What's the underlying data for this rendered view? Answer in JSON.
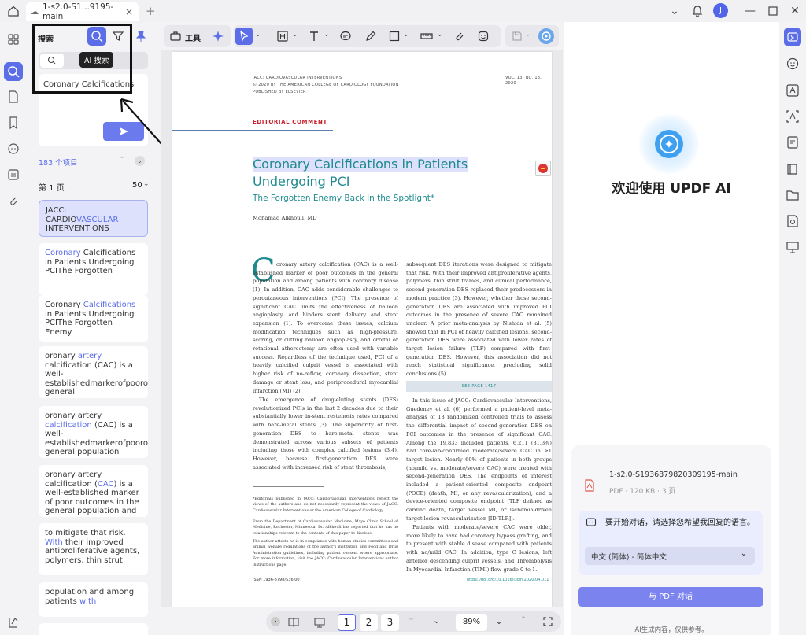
{
  "tab": {
    "title": "1-s2.0-S1...9195-main",
    "new_tab": "+"
  },
  "search_panel": {
    "title": "搜索",
    "ai_tooltip": "AI 搜索",
    "query": "Coronary Calcifications",
    "count": "183 个项目",
    "page_label": "第 1 页",
    "page_count": "50",
    "results": [
      {
        "pre": "JACC: CARDIO",
        "hit": "VASCULAR",
        "post": " INTERVENTIONS"
      },
      {
        "pre": "",
        "hit": "Coronary",
        "post": " Calcifications in Patients Undergoing PCIThe Forgotten"
      },
      {
        "pre": "Coronary ",
        "hit": "Calcifications",
        "post": " in Patients Undergoing PCIThe Forgotten Enemy"
      },
      {
        "pre": "oronary ",
        "hit": "artery",
        "post": " calcification (CAC) is a well-establishedmarkerofpoorou general"
      },
      {
        "pre": "oronary artery ",
        "hit": "calcification",
        "post": " (CAC) is a well-establishedmarkerofpoorou general population"
      },
      {
        "pre": "oronary artery calcification (",
        "hit": "CAC",
        "post": ") is a well-established marker of poor outcomes in the general population and"
      },
      {
        "pre": "to mitigate that risk. ",
        "hit": "With",
        "post": " their improved antiproliferative agents, polymers, thin strut"
      },
      {
        "pre": "population and among patients ",
        "hit": "with",
        "post": ""
      }
    ]
  },
  "toolbar": {
    "tools_label": "工具"
  },
  "document": {
    "journal": "JACC: CARDIOVASCULAR INTERVENTIONS",
    "copyright": "© 2020 BY THE AMERICAN COLLEGE OF CARDIOLOGY FOUNDATION",
    "publisher": "PUBLISHED BY ELSEVIER",
    "volume": "VOL. 13, NO. 13, 2020",
    "section": "EDITORIAL COMMENT",
    "title1": "Coronary Calcifications in Patients",
    "title2": "Undergoing PCI",
    "subtitle": "The Forgotten Enemy Back in the Spotlight*",
    "author": "Mohamad Alkhouli, MD",
    "dropcap": "C",
    "col1_p1": "oronary artery calcification (CAC) is a well-established marker of poor outcomes in the general population and among patients with coronary disease (1). In addition, CAC adds considerable challenges to percutaneous interventions (PCI). The presence of significant CAC limits the effectiveness of balloon angioplasty, and hinders stent delivery and stent expansion (1). To overcome these issues, calcium modification techniques such as high-pressure, scoring, or cutting balloon angioplasty, and orbital or rotational atherectomy are often used with variable success. Regardless of the technique used, PCI of a heavily calcified culprit vessel is associated with higher risk of no-reflow, coronary dissection, stent damage or stent loss, and periprocedural myocardial infarction (MI) (2).",
    "col1_p2": "The emergence of drug-eluting stents (DES) revolutionized PCIs in the last 2 decades due to their substantially lower in-stent restenosis rates compared with bare-metal stents (3). The superiority of first-generation DES to bare-metal stents was demonstrated across various subsets of patients including those with complex calcified lesions (3,4). However, because first-generation DES were associated with increased risk of stent thrombosis,",
    "footnote1": "*Editorials published in JACC: Cardiovascular Interventions reflect the views of the authors and do not necessarily represent the views of JACC: Cardiovascular Interventions or the American College of Cardiology.",
    "footnote2": "From the Department of Cardiovascular Medicine, Mayo Clinic School of Medicine, Rochester, Minnesota. Dr. Alkhouli has reported that he has no relationships relevant to the contents of this paper to disclose.",
    "footnote3": "The author attests he is in compliance with human studies committees and animal welfare regulations of the author's institution and Food and Drug Administration guidelines, including patient consent where appropriate. For more information, visit the JACC: Cardiovascular Interventions author instructions page.",
    "issn": "ISSN 1936-8798/$36.00",
    "doi": "https://doi.org/10.1016/j.jcin.2020.04.011",
    "col2_p1": "subsequent DES iterations were designed to mitigate that risk. With their improved antiproliferative agents, polymers, thin strut frames, and clinical performance, second-generation DES replaced their predecessors in modern practice (3). However, whether those second-generation DES are associated with improved PCI outcomes in the presence of severe CAC remained unclear. A prior meta-analysis by Nishida et al. (5) showed that in PCI of heavily calcified lesions, second-generation DES were associated with lower rates of target lesion failure (TLF) compared with first-generation DES. However, this association did not reach statistical significance, precluding solid conclusions (5).",
    "see_page": "SEE PAGE 1417",
    "col2_p2": "In this issue of JACC: Cardiovascular Interventions, Guedeney et al. (6) performed a patient-level meta-analysis of 18 randomized controlled trials to assess the differential impact of second-generation DES on PCI outcomes in the presence of significant CAC. Among the 19,833 included patients, 6,211 (31.3%) had core-lab-confirmed moderate/severe CAC in ≥1 target lesion. Nearly 60% of patients in both groups (no/mild vs. moderate/severe CAC) were treated with second-generation DES. The endpoints of interest included a patient-oriented composite endpoint (POCE) (death, MI, or any revascularization), and a device-oriented composite endpoint (TLF defined as cardiac death, target vessel MI, or ischemia-driven target lesion revascularization [ID-TLR]).",
    "col2_p3": "Patients with moderate/severe CAC were older, more likely to have had coronary bypass grafting, and to present with stable disease compared with patients with no/mild CAC. In addition, type C lesions, left anterior descending culprit vessels, and Thrombolysis In Myocardial Infarction (TIMI) flow grade 0 to 1."
  },
  "bottombar": {
    "pages": [
      "1",
      "2",
      "3"
    ],
    "zoom": "89%"
  },
  "ai_panel": {
    "welcome": "欢迎使用 UPDF AI",
    "file_name": "1-s2.0-S1936879820309195-main",
    "file_meta": "PDF · 120 KB · 3 页",
    "prompt": "要开始对话，请选择您希望我回复的语言。",
    "language": "中文 (简体) - 简体中文",
    "chat_button": "与 PDF 对话",
    "disclaimer": "AI生成内容，仅供参考。"
  },
  "colors": {
    "accent": "#5b6ee8",
    "section_red": "#c8202a",
    "title_teal": "#1f8a8f"
  }
}
